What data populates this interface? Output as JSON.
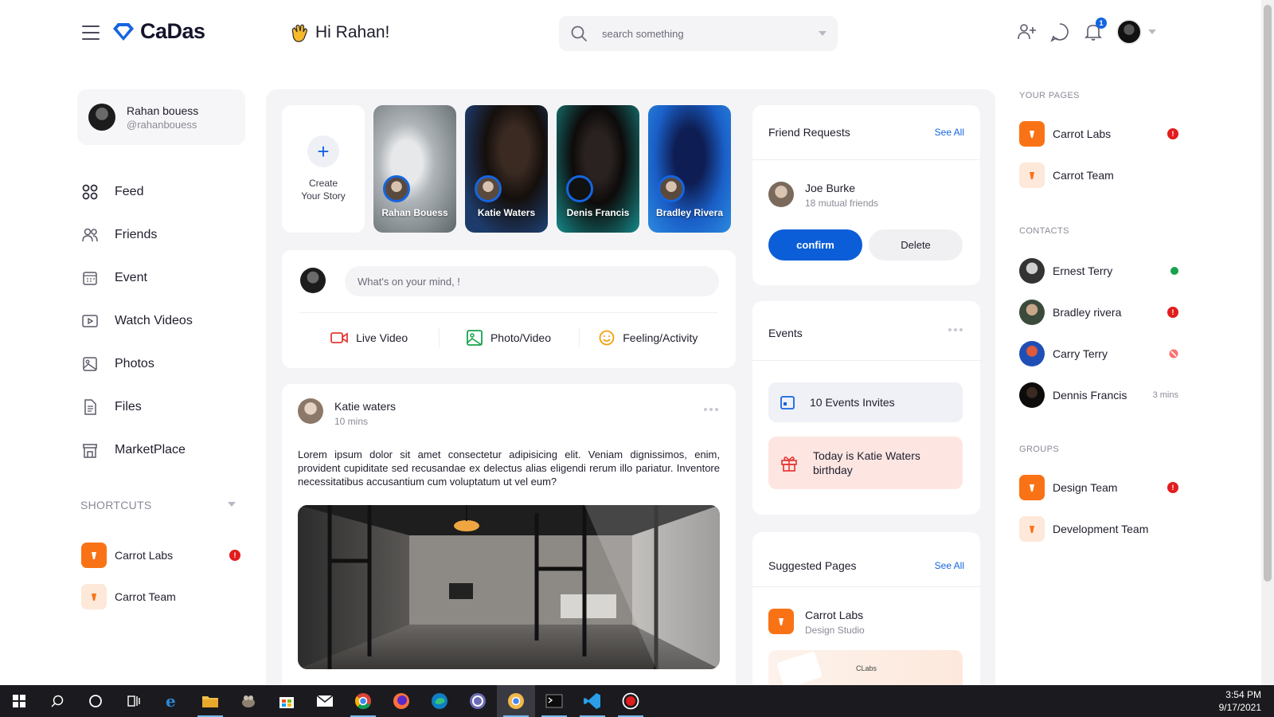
{
  "header": {
    "logo": "CaDas",
    "greeting": "Hi Rahan!",
    "search_placeholder": "search something",
    "notification_count": "1"
  },
  "profile": {
    "name": "Rahan bouess",
    "handle": "@rahanbouess"
  },
  "nav": [
    {
      "label": "Feed",
      "icon": "feed-icon"
    },
    {
      "label": "Friends",
      "icon": "friends-icon"
    },
    {
      "label": "Event",
      "icon": "event-icon"
    },
    {
      "label": "Watch Videos",
      "icon": "watch-videos-icon"
    },
    {
      "label": "Photos",
      "icon": "photos-icon"
    },
    {
      "label": "Files",
      "icon": "files-icon"
    },
    {
      "label": "MarketPlace",
      "icon": "marketplace-icon"
    }
  ],
  "shortcuts": {
    "title": "SHORTCUTS",
    "items": [
      {
        "label": "Carrot Labs",
        "badge": "!"
      },
      {
        "label": "Carrot Team"
      }
    ]
  },
  "stories": {
    "create_label_1": "Create",
    "create_label_2": "Your Story",
    "items": [
      {
        "name": "Rahan Bouess"
      },
      {
        "name": "Katie Waters"
      },
      {
        "name": "Denis Francis"
      },
      {
        "name": "Bradley Rivera"
      }
    ]
  },
  "composer": {
    "placeholder": "What's on your mind, !",
    "actions": [
      "Live Video",
      "Photo/Video",
      "Feeling/Activity"
    ]
  },
  "post": {
    "author": "Katie waters",
    "time": "10 mins",
    "text": "Lorem ipsum dolor sit amet consectetur adipisicing elit. Veniam dignissimos, enim, provident cupiditate sed recusandae ex delectus alias eligendi rerum illo pariatur. Inventore necessitatibus accusantium cum voluptatum ut vel eum?"
  },
  "friend_requests": {
    "title": "Friend Requests",
    "see_all": "See All",
    "name": "Joe Burke",
    "mutual": "18 mutual friends",
    "confirm": "confirm",
    "delete": "Delete"
  },
  "events": {
    "title": "Events",
    "invites": "10 Events Invites",
    "birthday_1": "Today is Katie Waters",
    "birthday_2": "birthday"
  },
  "suggested": {
    "title": "Suggested Pages",
    "see_all": "See All",
    "name": "Carrot Labs",
    "subtitle": "Design Studio",
    "preview_label": "CLabs"
  },
  "right": {
    "pages_title": "YOUR PAGES",
    "pages": [
      {
        "label": "Carrot Labs",
        "badge": "!"
      },
      {
        "label": "Carrot Team"
      }
    ],
    "contacts_title": "CONTACTS",
    "contacts": [
      {
        "label": "Ernest Terry",
        "status": "online"
      },
      {
        "label": "Bradley rivera",
        "badge": "!"
      },
      {
        "label": "Carry Terry",
        "status": "blocked"
      },
      {
        "label": "Dennis Francis",
        "time": "3 mins"
      }
    ],
    "groups_title": "GROUPS",
    "groups": [
      {
        "label": "Design Team",
        "badge": "!"
      },
      {
        "label": "Development Team"
      }
    ]
  },
  "taskbar": {
    "time": "3:54 PM",
    "date": "9/17/2021"
  },
  "colors": {
    "accent": "#1565e0",
    "orange": "#f97316",
    "badge_red": "#e11d1d",
    "online_green": "#16a34a"
  }
}
